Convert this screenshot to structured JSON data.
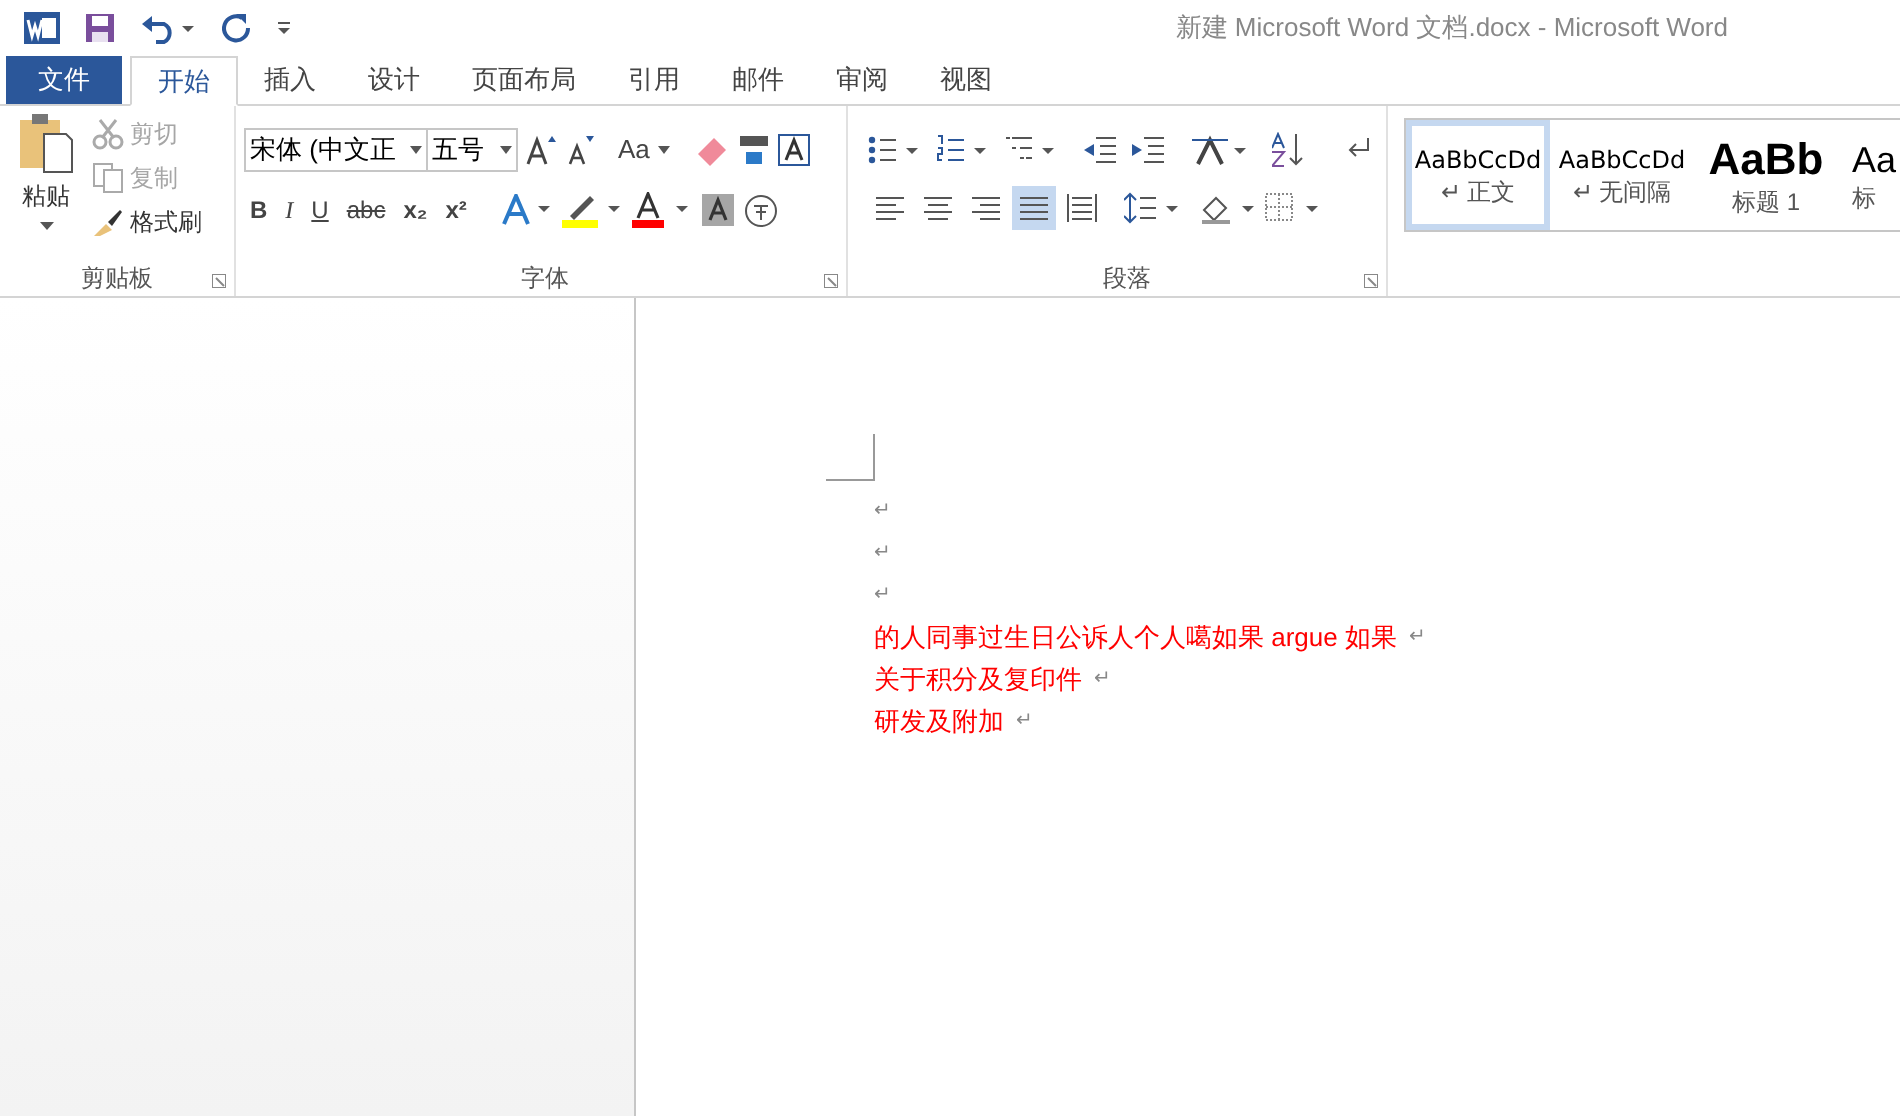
{
  "window": {
    "title": "新建 Microsoft Word 文档.docx - Microsoft Word"
  },
  "tabs": [
    {
      "label": "文件",
      "kind": "file",
      "selected": false
    },
    {
      "label": "开始",
      "kind": "tab",
      "selected": true
    },
    {
      "label": "插入",
      "kind": "tab",
      "selected": false
    },
    {
      "label": "设计",
      "kind": "tab",
      "selected": false
    },
    {
      "label": "页面布局",
      "kind": "tab",
      "selected": false
    },
    {
      "label": "引用",
      "kind": "tab",
      "selected": false
    },
    {
      "label": "邮件",
      "kind": "tab",
      "selected": false
    },
    {
      "label": "审阅",
      "kind": "tab",
      "selected": false
    },
    {
      "label": "视图",
      "kind": "tab",
      "selected": false
    }
  ],
  "clipboard": {
    "label": "剪贴板",
    "paste": "粘贴",
    "items": [
      {
        "label": "剪切",
        "disabled": true
      },
      {
        "label": "复制",
        "disabled": true
      },
      {
        "label": "格式刷",
        "disabled": false
      }
    ]
  },
  "font": {
    "label": "字体",
    "font_name": "宋体 (中文正",
    "font_size": "五号",
    "case_button": "Aa",
    "format_buttons": [
      "B",
      "I",
      "U",
      "abc",
      "x₂",
      "x²"
    ]
  },
  "paragraph": {
    "label": "段落",
    "alignments": [
      {
        "selected": false
      },
      {
        "selected": false
      },
      {
        "selected": false
      },
      {
        "selected": true
      },
      {
        "selected": false
      }
    ]
  },
  "styles": [
    {
      "preview": "AaBbCcDd",
      "name": "↵ 正文",
      "kind": "normal",
      "selected": true
    },
    {
      "preview": "AaBbCcDd",
      "name": "↵ 无间隔",
      "kind": "normal",
      "selected": false
    },
    {
      "preview": "AaBb",
      "name": "标题 1",
      "kind": "heading",
      "selected": false
    },
    {
      "preview": "Aa",
      "name": "标",
      "kind": "heading2",
      "selected": false
    }
  ],
  "document": {
    "paragraphs": [
      {
        "mark": "↵"
      },
      {
        "mark": "↵"
      },
      {
        "mark": "↵"
      },
      {
        "text": "的人同事过生日公诉人个人噶如果 argue 如果",
        "mark": "↵",
        "color": "#ff0000"
      },
      {
        "text": "关于积分及复印件",
        "mark": "↵",
        "color": "#ff0000"
      },
      {
        "text": "研发及附加",
        "mark": "↵",
        "color": "#ff0000"
      }
    ]
  }
}
